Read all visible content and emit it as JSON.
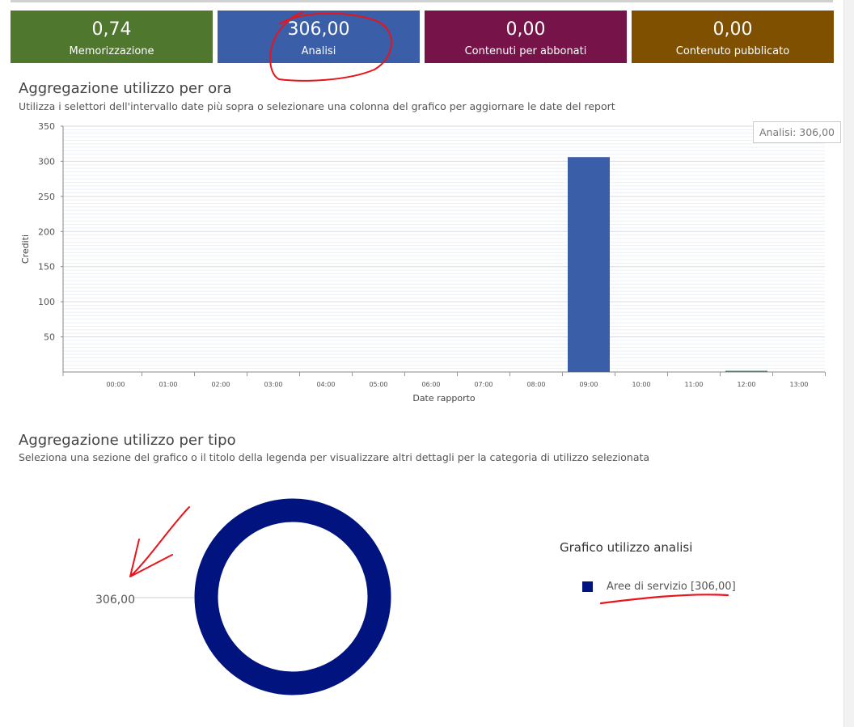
{
  "tiles": [
    {
      "value": "0,74",
      "label": "Memorizzazione",
      "color": "#4f772d"
    },
    {
      "value": "306,00",
      "label": "Analisi",
      "color": "#3a5ea8"
    },
    {
      "value": "0,00",
      "label": "Contenuti per abbonati",
      "color": "#761449"
    },
    {
      "value": "0,00",
      "label": "Contenuto pubblicato",
      "color": "#7f5000"
    }
  ],
  "hourly": {
    "title": "Aggregazione utilizzo per ora",
    "subtitle": "Utilizza i selettori dell'intervallo date più sopra o selezionare una colonna del grafico per aggiornare le date del report",
    "tooltip": "Analisi: 306,00"
  },
  "by_type": {
    "title": "Aggregazione utilizzo per tipo",
    "subtitle": "Seleziona una sezione del grafico o il titolo della legenda per visualizzare altri dettagli per la categoria di utilizzo selezionata",
    "donut_label": "306,00",
    "legend_title": "Grafico utilizzo analisi",
    "legend_item": "Aree di servizio [306,00]"
  },
  "colors": {
    "bar": "#3a5ea8",
    "donut": "#00137f",
    "annotation": "#e8141b"
  },
  "chart_data": [
    {
      "type": "bar",
      "title": "",
      "xlabel": "Date rapporto",
      "ylabel": "Crediti",
      "ylim": [
        0,
        350
      ],
      "yticks": [
        50,
        100,
        150,
        200,
        250,
        300,
        350
      ],
      "grid": true,
      "categories": [
        "00:00",
        "01:00",
        "02:00",
        "03:00",
        "04:00",
        "05:00",
        "06:00",
        "07:00",
        "08:00",
        "09:00",
        "10:00",
        "11:00",
        "12:00",
        "13:00"
      ],
      "series": [
        {
          "values": [
            0,
            0,
            0,
            0,
            0,
            0,
            0,
            0,
            0,
            306,
            0,
            0,
            0.74,
            0
          ]
        }
      ]
    },
    {
      "type": "pie",
      "title": "Grafico utilizzo analisi",
      "labels": [
        "Aree di servizio"
      ],
      "values": [
        306
      ]
    }
  ]
}
